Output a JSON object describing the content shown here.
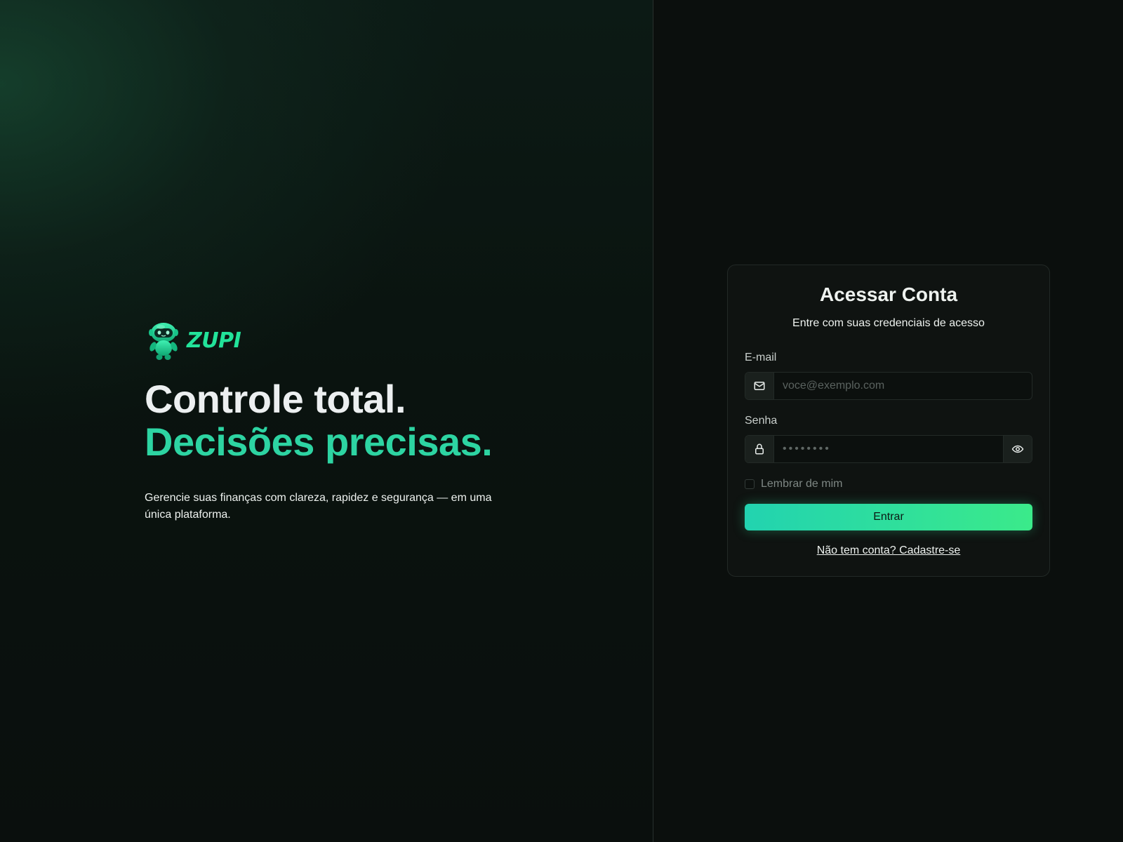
{
  "brand": {
    "name": "ZUPI",
    "accent": "#2dd4a2",
    "logo_icon": "robot-mascot-icon"
  },
  "hero": {
    "headline_line1": "Controle total.",
    "headline_line2": "Decisões precisas.",
    "subtitle": "Gerencie suas finanças com clareza, rapidez e segurança — em uma única plataforma."
  },
  "login": {
    "title": "Acessar Conta",
    "subtitle": "Entre com suas credenciais de acesso",
    "email": {
      "label": "E-mail",
      "placeholder": "voce@exemplo.com",
      "value": "",
      "icon": "mail-icon"
    },
    "password": {
      "label": "Senha",
      "placeholder": "••••••••",
      "value": "",
      "icon": "lock-icon",
      "toggle_icon": "eye-icon"
    },
    "remember_label": "Lembrar de mim",
    "remember_checked": false,
    "submit_label": "Entrar",
    "signup_link": "Não tem conta? Cadastre-se"
  }
}
